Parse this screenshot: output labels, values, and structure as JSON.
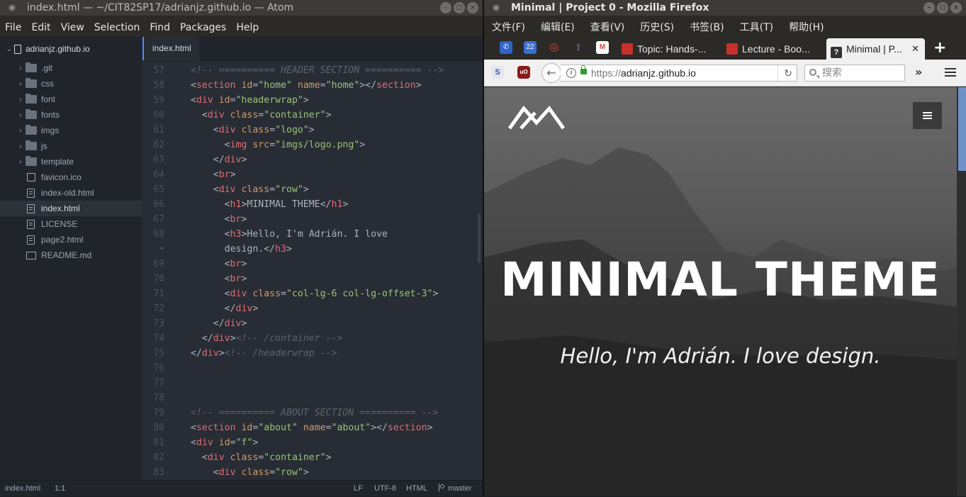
{
  "atom": {
    "window_title": "index.html — ~/CIT82SP17/adrianjz.github.io — Atom",
    "menu": [
      "File",
      "Edit",
      "View",
      "Selection",
      "Find",
      "Packages",
      "Help"
    ],
    "project_root": "adrianjz.github.io",
    "tree": [
      {
        "label": ".git",
        "type": "folder"
      },
      {
        "label": "css",
        "type": "folder"
      },
      {
        "label": "font",
        "type": "folder"
      },
      {
        "label": "fonts",
        "type": "folder"
      },
      {
        "label": "imgs",
        "type": "folder"
      },
      {
        "label": "js",
        "type": "folder"
      },
      {
        "label": "template",
        "type": "folder"
      },
      {
        "label": "favicon.ico",
        "type": "image"
      },
      {
        "label": "index-old.html",
        "type": "file"
      },
      {
        "label": "index.html",
        "type": "file",
        "selected": true
      },
      {
        "label": "LICENSE",
        "type": "file"
      },
      {
        "label": "page2.html",
        "type": "file"
      },
      {
        "label": "README.md",
        "type": "markdown"
      }
    ],
    "active_tab": "index.html",
    "code_lines": [
      {
        "num": "57",
        "text": "<!-- ========== HEADER SECTION ========== -->"
      },
      {
        "num": "58",
        "text": "<section id=\"home\" name=\"home\"></section>"
      },
      {
        "num": "59",
        "text": "<div id=\"headerwrap\">"
      },
      {
        "num": "60",
        "text": "  <div class=\"container\">"
      },
      {
        "num": "61",
        "text": "    <div class=\"logo\">"
      },
      {
        "num": "62",
        "text": "      <img src=\"imgs/logo.png\">"
      },
      {
        "num": "63",
        "text": "    </div>"
      },
      {
        "num": "64",
        "text": "    <br>"
      },
      {
        "num": "65",
        "text": "    <div class=\"row\">"
      },
      {
        "num": "66",
        "text": "      <h1>MINIMAL THEME</h1>"
      },
      {
        "num": "67",
        "text": "      <br>"
      },
      {
        "num": "68",
        "text": "      <h3>Hello, I'm Adrián. I love"
      },
      {
        "num": "•",
        "text": "      design.</h3>"
      },
      {
        "num": "69",
        "text": "      <br>"
      },
      {
        "num": "70",
        "text": "      <br>"
      },
      {
        "num": "71",
        "text": "      <div class=\"col-lg-6 col-lg-offset-3\">"
      },
      {
        "num": "72",
        "text": "      </div>"
      },
      {
        "num": "73",
        "text": "    </div>"
      },
      {
        "num": "74",
        "text": "  </div><!-- /container -->"
      },
      {
        "num": "75",
        "text": "</div><!-- /headerwrap -->"
      },
      {
        "num": "76",
        "text": ""
      },
      {
        "num": "77",
        "text": ""
      },
      {
        "num": "78",
        "text": ""
      },
      {
        "num": "79",
        "text": "<!-- ========== ABOUT SECTION ========== -->"
      },
      {
        "num": "80",
        "text": "<section id=\"about\" name=\"about\"></section>"
      },
      {
        "num": "81",
        "text": "<div id=\"f\">"
      },
      {
        "num": "82",
        "text": "  <div class=\"container\">"
      },
      {
        "num": "83",
        "text": "    <div class=\"row\">"
      }
    ],
    "status": {
      "file": "index.html",
      "cursor": "1:1",
      "line_ending": "LF",
      "encoding": "UTF-8",
      "grammar": "HTML",
      "branch": "master"
    }
  },
  "firefox": {
    "window_title": "Minimal | Project 0 - Mozilla Firefox",
    "menu": [
      "文件(F)",
      "编辑(E)",
      "查看(V)",
      "历史(S)",
      "书签(B)",
      "工具(T)",
      "帮助(H)"
    ],
    "pinned_badge": "22",
    "tabs": [
      {
        "label": "Topic: Hands-...",
        "active": false
      },
      {
        "label": "Lecture - Boo...",
        "active": false
      },
      {
        "label": "Minimal | P...",
        "active": true
      }
    ],
    "url_scheme": "https://",
    "url_host": "adrianjz.github.io",
    "search_placeholder": "搜索",
    "page": {
      "hero_title": "MINIMAL THEME",
      "hero_subtitle": "Hello, I'm Adrián. I love design."
    }
  },
  "colors": {
    "atom_bg": "#282c34",
    "atom_accent": "#568af2",
    "tag": "#e06c75",
    "attr": "#d19a66",
    "string": "#98c379",
    "comment": "#5c6370"
  }
}
